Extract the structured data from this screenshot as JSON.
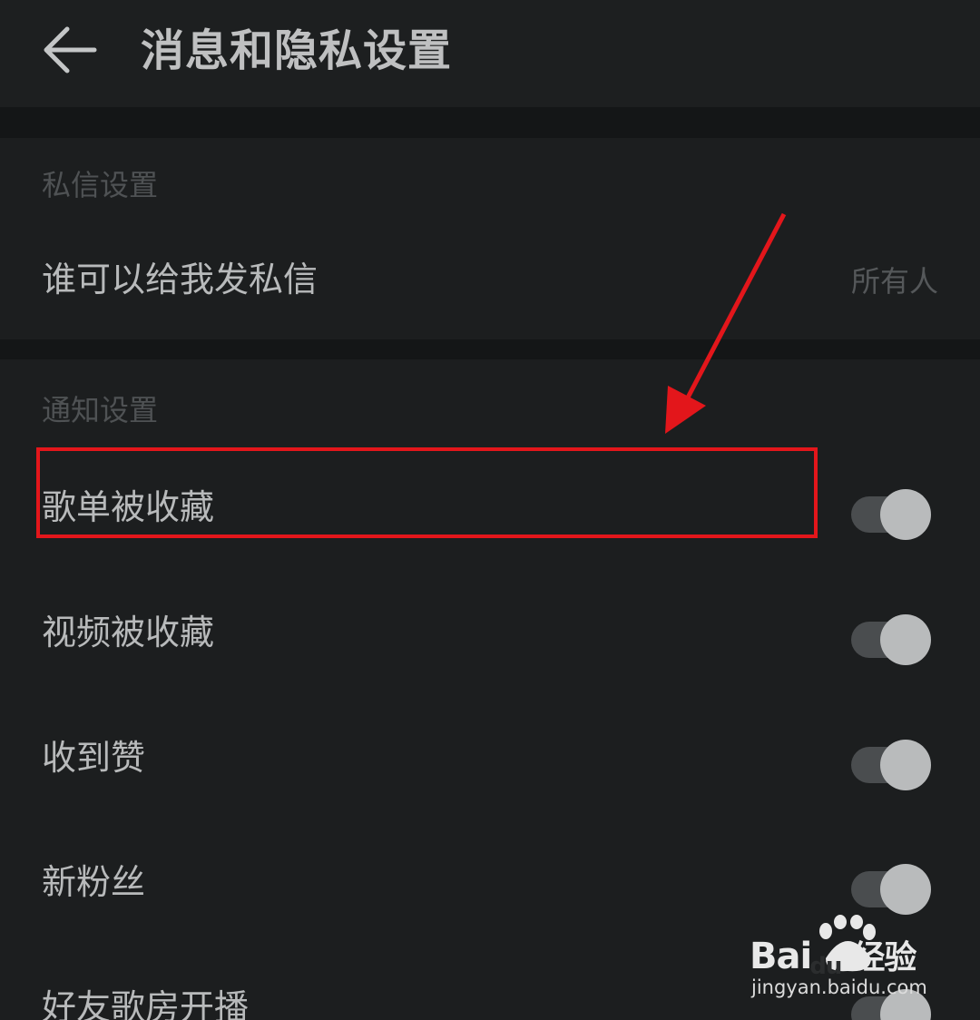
{
  "header": {
    "title": "消息和隐私设置",
    "back_icon": "back-arrow-icon"
  },
  "sections": {
    "private_message": {
      "title": "私信设置",
      "row": {
        "label": "谁可以给我发私信",
        "value": "所有人"
      }
    },
    "notification": {
      "title": "通知设置",
      "rows": [
        {
          "label": "歌单被收藏",
          "toggle": "on"
        },
        {
          "label": "视频被收藏",
          "toggle": "on"
        },
        {
          "label": "收到赞",
          "toggle": "on"
        },
        {
          "label": "新粉丝",
          "toggle": "on"
        },
        {
          "label": "好友歌房开播",
          "toggle": "on"
        }
      ]
    }
  },
  "annotation": {
    "color": "#e3161b"
  },
  "watermark": {
    "brand_latin": "Bai",
    "brand_du": "du",
    "brand_cn": "经验",
    "url": "jingyan.baidu.com"
  },
  "colors": {
    "background": "#1b1d1e",
    "text_primary": "#b8babb",
    "text_secondary": "#55585a",
    "accent_red": "#e3161b"
  }
}
